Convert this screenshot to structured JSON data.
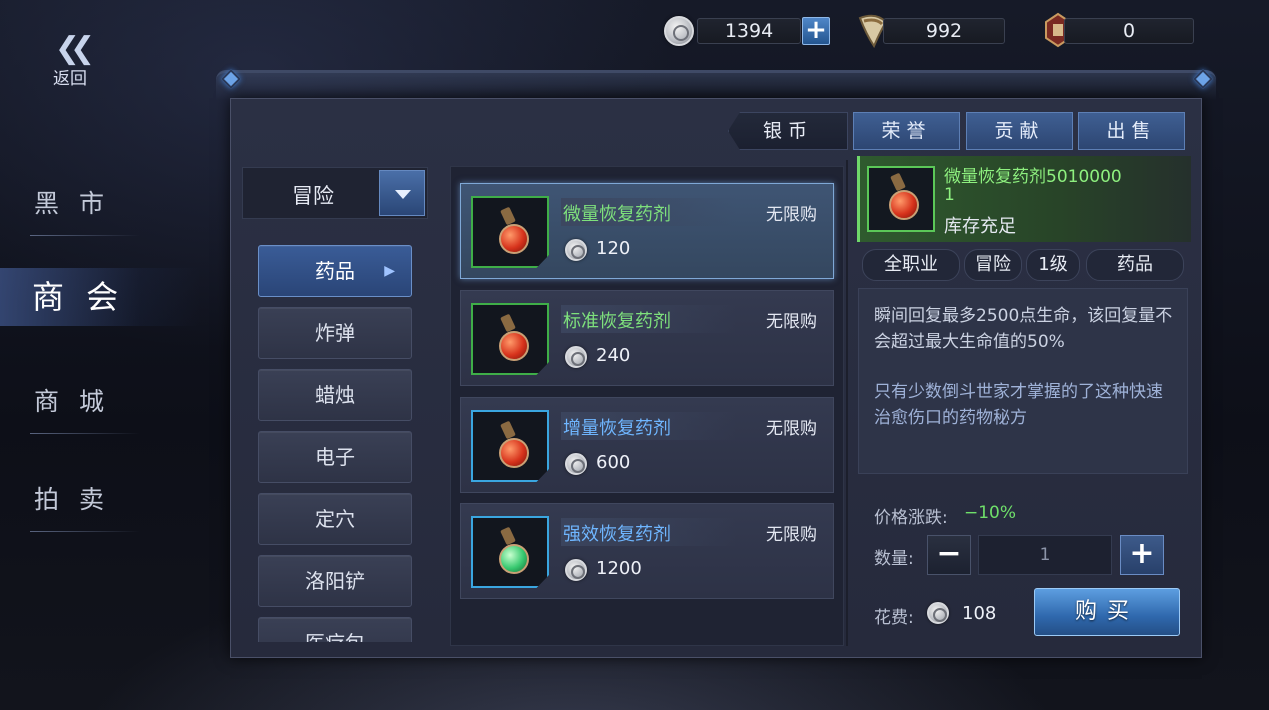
{
  "currency": {
    "silver": "1394",
    "honor": "992",
    "contribution": "0"
  },
  "nav": {
    "back_label": "返回",
    "items": [
      {
        "label": "黑 市",
        "active": false
      },
      {
        "label": "商 会",
        "active": true
      },
      {
        "label": "商 城",
        "active": false
      },
      {
        "label": "拍 卖",
        "active": false
      }
    ]
  },
  "tabs": [
    {
      "label": "银币",
      "active": true
    },
    {
      "label": "荣誉",
      "active": false
    },
    {
      "label": "贡献",
      "active": false
    },
    {
      "label": "出售",
      "active": false
    }
  ],
  "category_dropdown": {
    "selected": "冒险"
  },
  "categories": [
    {
      "label": "药品",
      "active": true
    },
    {
      "label": "炸弹",
      "active": false
    },
    {
      "label": "蜡烛",
      "active": false
    },
    {
      "label": "电子",
      "active": false
    },
    {
      "label": "定穴",
      "active": false
    },
    {
      "label": "洛阳铲",
      "active": false
    },
    {
      "label": "医疗包",
      "active": false
    }
  ],
  "items": [
    {
      "name": "微量恢复药剂",
      "limit": "无限购",
      "price": "120",
      "color": "green",
      "active": true
    },
    {
      "name": "标准恢复药剂",
      "limit": "无限购",
      "price": "240",
      "color": "green",
      "active": false
    },
    {
      "name": "增量恢复药剂",
      "limit": "无限购",
      "price": "600",
      "color": "blue",
      "active": false
    },
    {
      "name": "强效恢复药剂",
      "limit": "无限购",
      "price": "1200",
      "color": "blue",
      "active": false
    }
  ],
  "detail": {
    "name": "微量恢复药剂50100001",
    "stock": "库存充足",
    "tags": [
      "全职业",
      "冒险",
      "1级",
      "药品"
    ],
    "description": "瞬间回复最多2500点生命，该回复量不会超过最大生命值的50%",
    "lore": "只有少数倒斗世家才掌握的了这种快速治愈伤口的药物秘方",
    "price_change_label": "价格涨跌:",
    "price_change_value": "−10%",
    "quantity_label": "数量:",
    "quantity": "1",
    "cost_label": "花费:",
    "cost": "108",
    "buy_label": "购买"
  },
  "colors": {
    "accent_blue": "#2f68ad",
    "item_green": "#7ee07c",
    "item_blue": "#6fb6ff",
    "price_down": "#6fe06a"
  }
}
